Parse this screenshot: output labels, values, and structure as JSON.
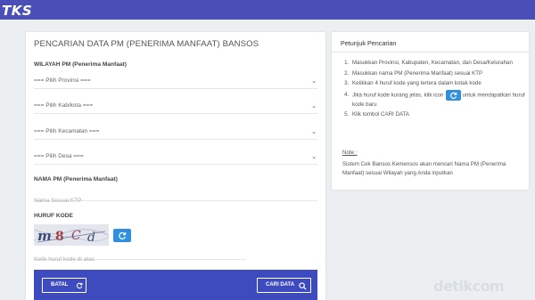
{
  "header": {
    "logo_text": "TKS",
    "bg_color": "#4a4fb8"
  },
  "form": {
    "title": "PENCARIAN DATA PM (PENERIMA MANFAAT) BANSOS",
    "wilayah_label": "WILAYAH PM (Penerima Manfaat)",
    "selects": {
      "provinsi": "=== Pilih Provinsi ===",
      "kabkota": "=== Pilih Kab/kota ===",
      "kecamatan": "=== Pilih Kecamatan ===",
      "desa": "=== Pilih Desa ==="
    },
    "nama_label": "NAMA PM (Penerima Manfaat)",
    "nama_placeholder": "Nama Sesuai KTP",
    "kode_label": "HURUF KODE",
    "captcha_chars": [
      "m",
      "8",
      "C",
      "d"
    ],
    "kode_placeholder": "Ketik huruf kode di atas",
    "batal_label": "BATAL",
    "cari_label": "CARI DATA",
    "accent_color": "#3d4bbf"
  },
  "petunjuk": {
    "title": "Petunjuk Pencarian",
    "steps": [
      "Masukkan Provinsi, Kabupaten, Kecamatan, dan Desa/Kelurahan",
      "Masukkan nama PM (Penerima Manfaat) sesuai KTP",
      "Ketikkan 4 huruf kode yang tertera dalam kotak kode"
    ],
    "step4_before": "Jika huruf kode kurang jelas, klik icon",
    "step4_after": "untuk mendapatkan huruf kode baru",
    "step5": "Klik tombol CARI DATA",
    "note_label": "Note :",
    "note_text": "Sistem Cek Bansos Kemensos akan mencari Nama PM (Penerima Manfaat) sesuai Wilayah yang Anda inputkan"
  },
  "watermark": "detikcom"
}
